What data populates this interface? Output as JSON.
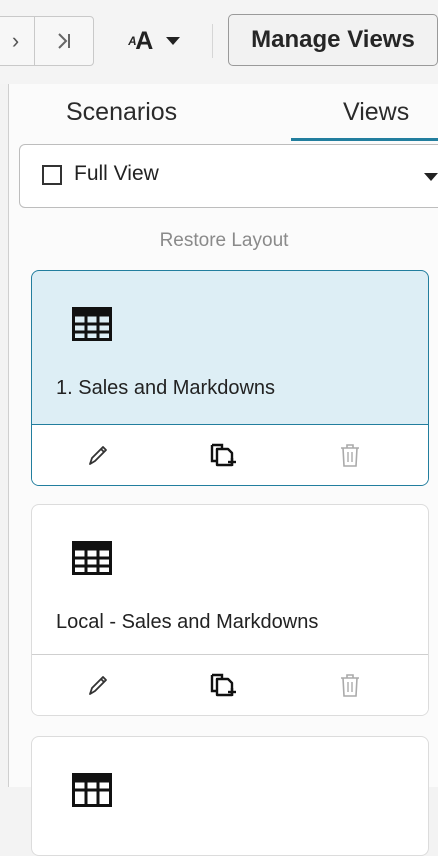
{
  "toolbar": {
    "prev_icon": "chevron-right-icon",
    "last_icon": "chevron-last-icon",
    "font_size_label": "A",
    "font_size_small": "ᴬ",
    "manage_views_label": "Manage Views"
  },
  "tabs": [
    {
      "label": "Scenarios",
      "selected": false
    },
    {
      "label": "Views",
      "selected": true
    }
  ],
  "view_selector": {
    "value": "Full View",
    "checked": false
  },
  "restore_layout_label": "Restore Layout",
  "views": [
    {
      "title": "1. Sales and Markdowns",
      "selected": true,
      "icon": "table-icon"
    },
    {
      "title": "Local - Sales and Markdowns",
      "selected": false,
      "icon": "table-icon"
    },
    {
      "title": "",
      "selected": false,
      "icon": "table-icon"
    }
  ],
  "colors": {
    "accent": "#227e9e",
    "selected_bg": "#ddeef5"
  }
}
